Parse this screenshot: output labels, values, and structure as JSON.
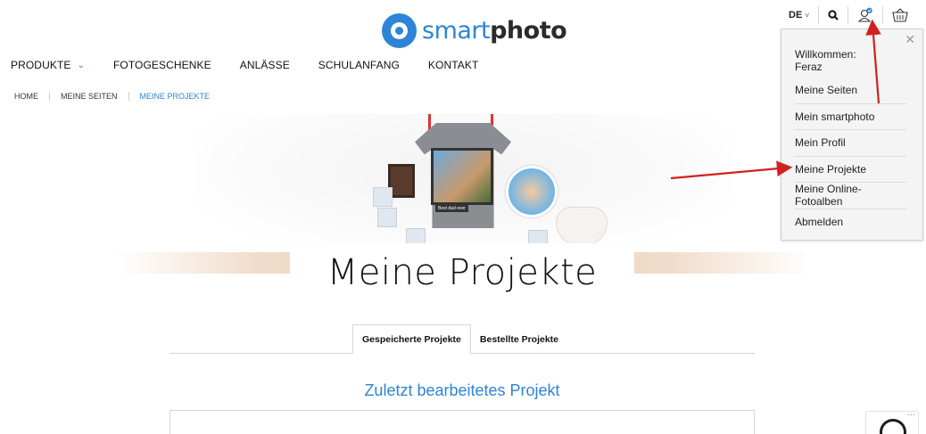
{
  "brand": {
    "name_light": "smart",
    "name_bold": "photo",
    "accent": "#2f84d6"
  },
  "top_tools": {
    "language": "DE",
    "user_icon": "user-icon",
    "search_icon": "search-icon",
    "cart_icon": "basket-icon"
  },
  "nav": {
    "items": [
      {
        "label": "PRODUKTE",
        "has_dropdown": true
      },
      {
        "label": "FOTOGESCHENKE"
      },
      {
        "label": "ANLÄSSE"
      },
      {
        "label": "SCHULANFANG"
      },
      {
        "label": "KONTAKT"
      }
    ]
  },
  "breadcrumb": [
    "HOME",
    "MEINE SEITEN",
    "MEINE PROJEKTE"
  ],
  "hero": {
    "title": "Meine Projekte",
    "shirt_text": "Best dad ever"
  },
  "tabs": [
    {
      "label": "Gespeicherte Projekte",
      "active": true
    },
    {
      "label": "Bestellte Projekte",
      "active": false
    }
  ],
  "section_title": "Zuletzt bearbeitetes Projekt",
  "user_menu": {
    "welcome": "Willkommen:",
    "user_name": "Feraz",
    "items": [
      "Meine Seiten",
      "Mein smartphoto",
      "Mein Profil",
      "Meine Projekte",
      "Meine Online-Fotoalben",
      "Abmelden"
    ],
    "close_icon": "close-icon"
  },
  "annotation_color": "#d22020"
}
